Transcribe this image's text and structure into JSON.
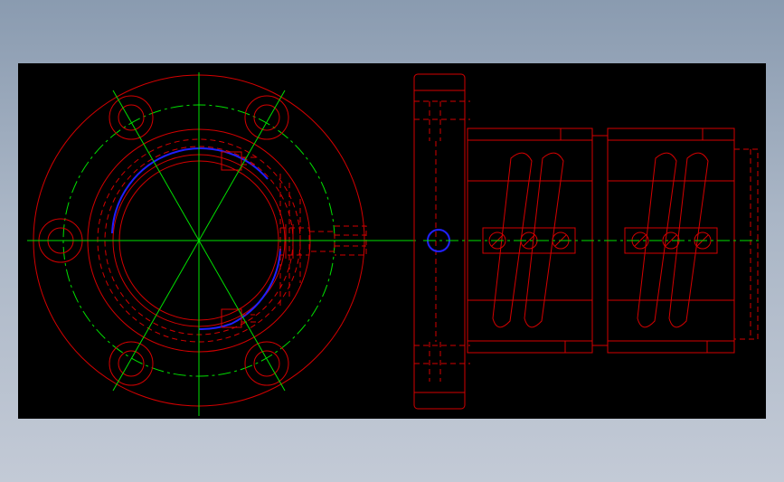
{
  "viewer": {
    "background": "#000000",
    "frame_gradient_top": "#8a9bb0",
    "frame_gradient_bottom": "#c3cad6"
  },
  "drawing": {
    "layers": {
      "outline": "#d40000",
      "centerline": "#00e000",
      "highlight": "#2020ff"
    },
    "views": [
      "front-view-flange",
      "side-view-ball-nut"
    ]
  }
}
